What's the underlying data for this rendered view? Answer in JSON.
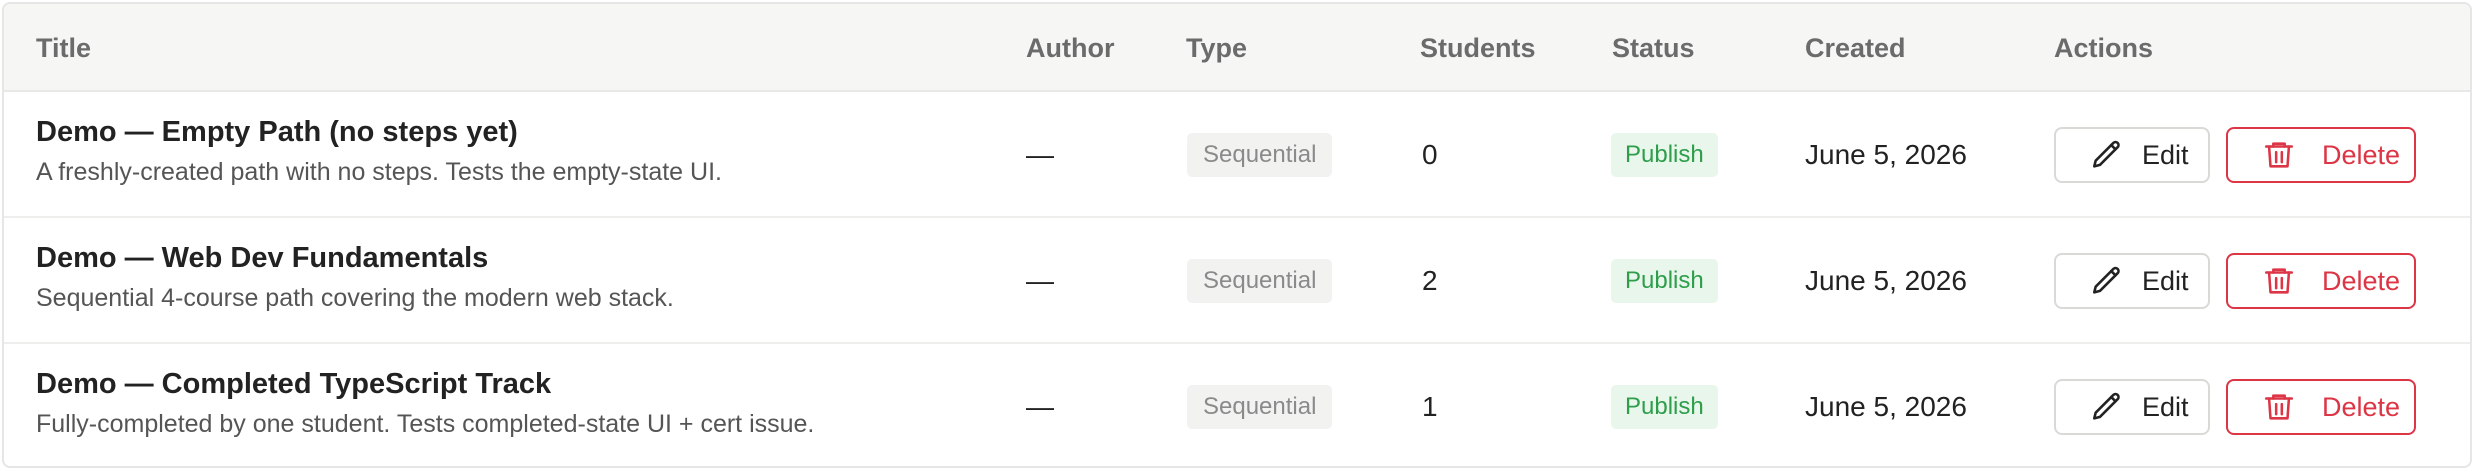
{
  "columns": {
    "title": "Title",
    "author": "Author",
    "type": "Type",
    "students": "Students",
    "status": "Status",
    "created": "Created",
    "actions": "Actions"
  },
  "rows": [
    {
      "title": "Demo — Empty Path (no steps yet)",
      "description": "A freshly-created path with no steps. Tests the empty-state UI.",
      "author": "—",
      "type": "Sequential",
      "students": "0",
      "status": "Publish",
      "created": "June 5, 2026",
      "edit_label": "Edit",
      "delete_label": "Delete"
    },
    {
      "title": "Demo — Web Dev Fundamentals",
      "description": "Sequential 4-course path covering the modern web stack.",
      "author": "—",
      "type": "Sequential",
      "students": "2",
      "status": "Publish",
      "created": "June 5, 2026",
      "edit_label": "Edit",
      "delete_label": "Delete"
    },
    {
      "title": "Demo — Completed TypeScript Track",
      "description": "Fully-completed by one student. Tests completed-state UI + cert issue.",
      "author": "—",
      "type": "Sequential",
      "students": "1",
      "status": "Publish",
      "created": "June 5, 2026",
      "edit_label": "Edit",
      "delete_label": "Delete"
    }
  ],
  "icons": {
    "edit": "pencil-icon",
    "delete": "trash-icon"
  },
  "colors": {
    "status_text": "#2e9e4b",
    "status_bg": "#e9f6ec",
    "danger": "#dc3545",
    "header_bg": "#f6f6f5"
  }
}
